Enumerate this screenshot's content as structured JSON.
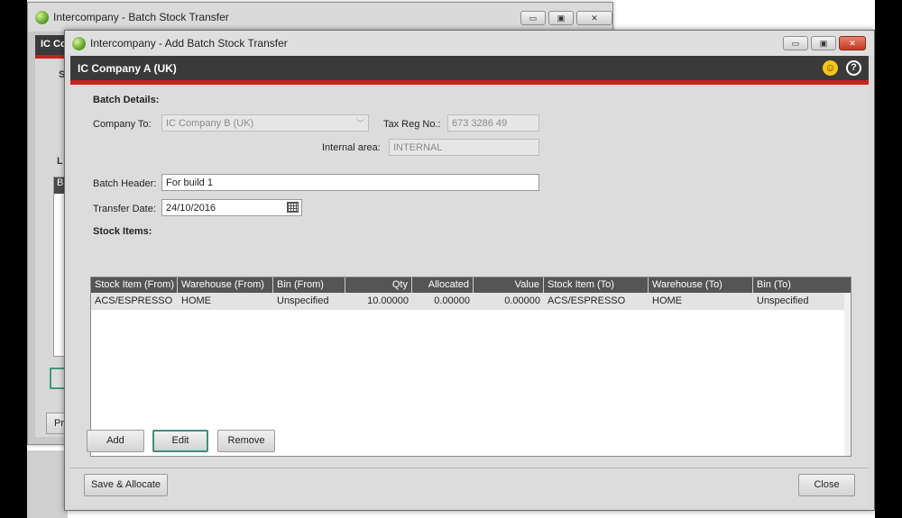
{
  "background_window": {
    "title": "Intercompany - Batch Stock Transfer",
    "company_fragment": "IC Co",
    "frag_s": "S",
    "frag_l": "L",
    "frag_b": "B",
    "frag_pr": "Pr",
    "controls": {
      "minimize": "▭",
      "restore": "▣",
      "close": "✕"
    }
  },
  "window": {
    "title": "Intercompany - Add Batch Stock Transfer",
    "controls": {
      "minimize": "▭",
      "restore": "▣",
      "close": "✕"
    }
  },
  "header": {
    "company": "IC Company A (UK)",
    "smiley": "☺",
    "help": "?"
  },
  "batch_details": {
    "section_title": "Batch Details:",
    "company_to_label": "Company To:",
    "company_to_value": "IC Company B (UK)",
    "tax_reg_label": "Tax Reg No.:",
    "tax_reg_value": "673 3286 49",
    "internal_area_label": "Internal area:",
    "internal_area_value": "INTERNAL",
    "batch_header_label": "Batch Header:",
    "batch_header_value": "For build 1",
    "transfer_date_label": "Transfer Date:",
    "transfer_date_value": "24/10/2016"
  },
  "stock_items": {
    "section_title": "Stock Items:",
    "columns": [
      "Stock Item (From)",
      "Warehouse (From)",
      "Bin (From)",
      "Qty",
      "Allocated",
      "Value",
      "Stock Item (To)",
      "Warehouse (To)",
      "Bin (To)"
    ],
    "rows": [
      [
        "ACS/ESPRESSO",
        "HOME",
        "Unspecified",
        "10.00000",
        "0.00000",
        "0.00000",
        "ACS/ESPRESSO",
        "HOME",
        "Unspecified"
      ]
    ]
  },
  "buttons": {
    "add": "Add",
    "edit": "Edit",
    "remove": "Remove",
    "save_allocate": "Save & Allocate",
    "close": "Close"
  }
}
